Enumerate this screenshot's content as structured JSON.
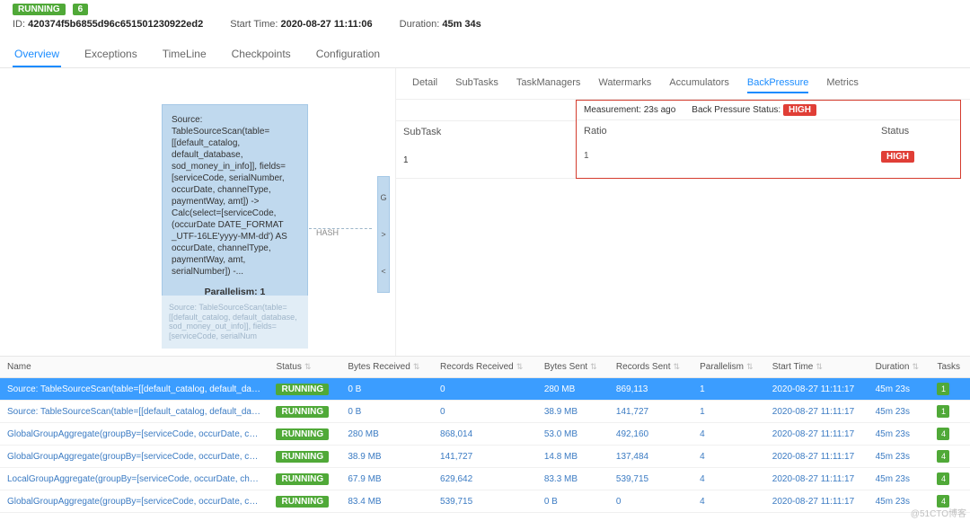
{
  "header": {
    "status": "RUNNING",
    "count": "6",
    "id_label": "ID:",
    "id": "420374f5b6855d96c651501230922ed2",
    "start_label": "Start Time:",
    "start": "2020-08-27 11:11:06",
    "dur_label": "Duration:",
    "dur": "45m 34s"
  },
  "main_tabs": [
    "Overview",
    "Exceptions",
    "TimeLine",
    "Checkpoints",
    "Configuration"
  ],
  "main_tab_active": 0,
  "node": {
    "title": "Source: TableSourceScan(table=[[default_catalog, default_database, sod_money_in_info]], fields=[serviceCode, serialNumber, occurDate, channelType, paymentWay, amt]) -> Calc(select=[serviceCode, (occurDate DATE_FORMAT _UTF-16LE'yyyy-MM-dd') AS occurDate, channelType, paymentWay, amt, serialNumber]) -...",
    "par": "Parallelism: 1"
  },
  "node_faded": "Source: TableSourceScan(table=[[default_catalog, default_database, sod_money_out_info]], fields=[serviceCode, serialNum",
  "hash": "HASH",
  "sub_tabs": [
    "Detail",
    "SubTasks",
    "TaskManagers",
    "Watermarks",
    "Accumulators",
    "BackPressure",
    "Metrics"
  ],
  "sub_tab_active": 5,
  "bp": {
    "measurement": "Measurement: 23s ago",
    "status_label": "Back Pressure Status:",
    "status_val": "HIGH",
    "subtask_h": "SubTask",
    "ratio_h": "Ratio",
    "status_h": "Status",
    "row": {
      "subtask": "1",
      "ratio": "1",
      "status": "HIGH"
    }
  },
  "grid": {
    "cols": [
      "Name",
      "Status",
      "Bytes Received",
      "Records Received",
      "Bytes Sent",
      "Records Sent",
      "Parallelism",
      "Start Time",
      "Duration",
      "Tasks"
    ],
    "rows": [
      {
        "sel": true,
        "name": "Source: TableSourceScan(table=[[default_catalog, default_database, s...",
        "status": "RUNNING",
        "br": "0 B",
        "rr": "0",
        "bs": "280 MB",
        "rs": "869,113",
        "par": "1",
        "start": "2020-08-27 11:11:17",
        "dur": "45m 23s",
        "tasks": "1"
      },
      {
        "name": "Source: TableSourceScan(table=[[default_catalog, default_database, s...",
        "status": "RUNNING",
        "br": "0 B",
        "rr": "0",
        "bs": "38.9 MB",
        "rs": "141,727",
        "par": "1",
        "start": "2020-08-27 11:11:17",
        "dur": "45m 23s",
        "tasks": "1"
      },
      {
        "name": "GlobalGroupAggregate(groupBy=[serviceCode, occurDate, channelTy...",
        "status": "RUNNING",
        "br": "280 MB",
        "rr": "868,014",
        "bs": "53.0 MB",
        "rs": "492,160",
        "par": "4",
        "start": "2020-08-27 11:11:17",
        "dur": "45m 23s",
        "tasks": "4"
      },
      {
        "name": "GlobalGroupAggregate(groupBy=[serviceCode, occurDate, channelTy...",
        "status": "RUNNING",
        "br": "38.9 MB",
        "rr": "141,727",
        "bs": "14.8 MB",
        "rs": "137,484",
        "par": "4",
        "start": "2020-08-27 11:11:17",
        "dur": "45m 23s",
        "tasks": "4"
      },
      {
        "name": "LocalGroupAggregate(groupBy=[serviceCode, occurDate, channelTyp...",
        "status": "RUNNING",
        "br": "67.9 MB",
        "rr": "629,642",
        "bs": "83.3 MB",
        "rs": "539,715",
        "par": "4",
        "start": "2020-08-27 11:11:17",
        "dur": "45m 23s",
        "tasks": "4"
      },
      {
        "name": "GlobalGroupAggregate(groupBy=[serviceCode, occurDate, channelTy...",
        "status": "RUNNING",
        "br": "83.4 MB",
        "rr": "539,715",
        "bs": "0 B",
        "rs": "0",
        "par": "4",
        "start": "2020-08-27 11:11:17",
        "dur": "45m 23s",
        "tasks": "4"
      }
    ]
  },
  "watermark": "@51CTO博客"
}
